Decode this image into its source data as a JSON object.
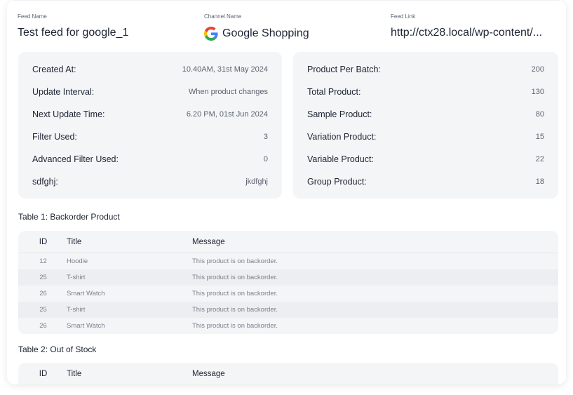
{
  "feed": {
    "feed_name_label": "Feed Name",
    "feed_name": "Test feed for google_1",
    "channel_name_label": "Channel Name",
    "channel_name": "Google Shopping",
    "channel_icon": "google-logo-icon",
    "feed_link_label": "Feed Link",
    "feed_link": "http://ctx28.local/wp-content/..."
  },
  "left_info": [
    {
      "label": "Created At:",
      "value": "10.40AM, 31st May 2024"
    },
    {
      "label": "Update Interval:",
      "value": "When product changes"
    },
    {
      "label": "Next Update Time:",
      "value": "6.20 PM, 01st Jun 2024"
    },
    {
      "label": "Filter Used:",
      "value": "3"
    },
    {
      "label": "Advanced Filter Used:",
      "value": "0"
    },
    {
      "label": "sdfghj:",
      "value": "jkdfghj"
    }
  ],
  "right_info": [
    {
      "label": "Product Per Batch:",
      "value": "200"
    },
    {
      "label": "Total Product:",
      "value": "130"
    },
    {
      "label": "Sample Product:",
      "value": "80"
    },
    {
      "label": "Variation Product:",
      "value": "15"
    },
    {
      "label": "Variable Product:",
      "value": "22"
    },
    {
      "label": "Group Product:",
      "value": "18"
    }
  ],
  "table1": {
    "title": "Table 1: Backorder Product",
    "headers": {
      "id": "ID",
      "title": "Title",
      "message": "Message"
    },
    "rows": [
      {
        "id": "12",
        "title": "Hoodie",
        "message": "This product is on backorder."
      },
      {
        "id": "25",
        "title": "T-shirt",
        "message": "This product is on backorder."
      },
      {
        "id": "26",
        "title": "Smart Watch",
        "message": "This product is on backorder."
      },
      {
        "id": "25",
        "title": "T-shirt",
        "message": "This product is on backorder."
      },
      {
        "id": "26",
        "title": "Smart Watch",
        "message": "This product is on backorder."
      }
    ]
  },
  "table2": {
    "title": "Table 2: Out of Stock",
    "headers": {
      "id": "ID",
      "title": "Title",
      "message": "Message"
    }
  },
  "colors": {
    "panel_bg": "#f4f5f7",
    "text_primary": "#1d2433",
    "text_muted": "#7a818c"
  }
}
